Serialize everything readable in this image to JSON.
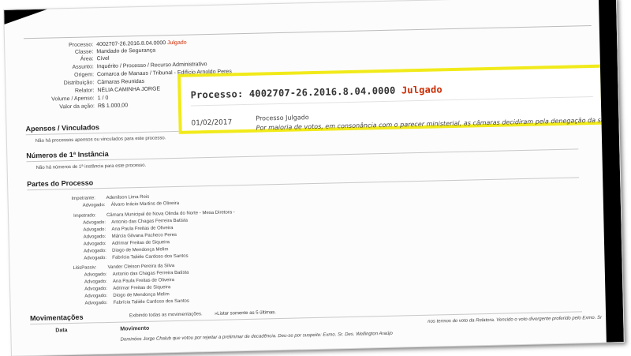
{
  "header": {
    "processo_label": "Processo:",
    "processo_num": "4002707-26.2016.8.04.0000",
    "status": "Julgado",
    "fields": [
      {
        "label": "Classe:",
        "value": "Mandado de Segurança"
      },
      {
        "label": "Área:",
        "value": "Cível"
      },
      {
        "label": "Assunto:",
        "value": "Inquérito / Processo / Recurso Administrativo"
      },
      {
        "label": "Origem:",
        "value": "Comarca de Manaus / Tribunal - Edifício Arnoldo Peres"
      },
      {
        "label": "Distribuição:",
        "value": "Câmaras Reunidas"
      },
      {
        "label": "Relator:",
        "value": "NÉLIA CAMINHA JORGE"
      },
      {
        "label": "Volume / Apenso:",
        "value": "1 / 0"
      },
      {
        "label": "Valor da ação:",
        "value": "R$ 1.000,00"
      }
    ]
  },
  "highlight": {
    "processo_label": "Processo:",
    "processo_num": "4002707-26.2016.8.04.0000",
    "status": "Julgado",
    "date": "01/02/2017",
    "event": "Processo Julgado",
    "text": "Por maioria de votos, em consonância com o parecer ministerial, as câmaras decidiram pela denegação da segurança impetrada."
  },
  "apensos": {
    "title": "Apensos / Vinculados",
    "note": "Não há processos apensos ou vinculados para este processo."
  },
  "numeros": {
    "title": "Números de 1ª Instância",
    "note": "Não há números de 1ª instância para este processo."
  },
  "partes": {
    "title": "Partes do Processo",
    "impetrante_label": "Impetrante:",
    "impetrante": "Adenilson Lima Reis",
    "impetrante_adv_label": "Advogado:",
    "impetrante_adv": "Álvaro Inácio Martins de Oliveira",
    "impetrado_label": "Impetrado:",
    "impetrado": "Câmara Municipal de Nova Olinda do Norte - Mesa Diretora -",
    "impetrado_advs": [
      "Antonio das Chagas Ferreira Batista",
      "Ana Paula Freitas de Oliveira",
      "Márcia Gilvana Pacheco Peres",
      "Adrimar Freitas de Siqueira",
      "Diogo de Mendonça Melim",
      "Fabrícia Talièle Cardoso dos Santos"
    ],
    "litis_label": "LitisPassiv:",
    "litis": "Vander Cleison Pereira da Silva",
    "litis_advs": [
      "Antonio das Chagas Ferreira Batista",
      "Ana Paula Freitas de Oliveira",
      "Adrimar Freitas de Siqueira",
      "Diogo de Mendonça Melim",
      "Fabrícia Talièle Cardoso dos Santos"
    ],
    "adv_label": "Advogado:"
  },
  "movimentacoes": {
    "title": "Movimentações",
    "showing": "Exibindo todas as movimentações.",
    "link": "»Listar somente as 5 últimas.",
    "col_data": "Data",
    "col_mov": "Movimento",
    "line1": "nos termos do voto da Relatora. Vencido o voto divergente proferido pelo Exmo. Sr",
    "line2": "Dominóos Jorge Chalub que votou por rejeitar a preliminar de decadência. Deu-se por suspeito: Exmo. Sr. Des. Wellington Araújo"
  }
}
